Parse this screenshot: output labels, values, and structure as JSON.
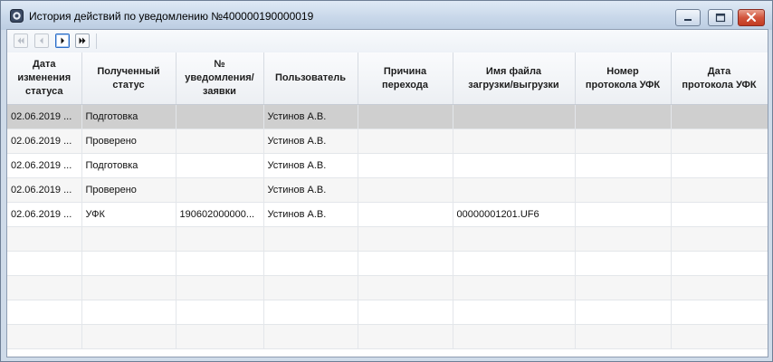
{
  "window": {
    "title": "История действий по уведомлению №400000190000019"
  },
  "toolbar": {
    "buttons": [
      {
        "name": "first-page",
        "icon": "double-left-icon",
        "enabled": false
      },
      {
        "name": "prev-page",
        "icon": "left-icon",
        "enabled": false
      },
      {
        "name": "next-page",
        "icon": "right-icon",
        "enabled": true
      },
      {
        "name": "last-page",
        "icon": "double-right-icon",
        "enabled": true
      }
    ]
  },
  "table": {
    "columns": [
      "Дата\nизменения\nстатуса",
      "Полученный\nстатус",
      "№\nуведомления/\nзаявки",
      "Пользователь",
      "Причина\nперехода",
      "Имя файла\nзагрузки/выгрузки",
      "Номер\nпротокола УФК",
      "Дата\nпротокола УФК"
    ],
    "rows": [
      [
        "02.06.2019 ...",
        "Подготовка",
        "",
        "Устинов А.В.",
        "",
        "",
        "",
        ""
      ],
      [
        "02.06.2019 ...",
        "Проверено",
        "",
        "Устинов А.В.",
        "",
        "",
        "",
        ""
      ],
      [
        "02.06.2019 ...",
        "Подготовка",
        "",
        "Устинов А.В.",
        "",
        "",
        "",
        ""
      ],
      [
        "02.06.2019 ...",
        "Проверено",
        "",
        "Устинов А.В.",
        "",
        "",
        "",
        ""
      ],
      [
        "02.06.2019 ...",
        "УФК",
        "190602000000...",
        "Устинов А.В.",
        "",
        "00000001201.UF6",
        "",
        ""
      ],
      [
        "",
        "",
        "",
        "",
        "",
        "",
        "",
        ""
      ],
      [
        "",
        "",
        "",
        "",
        "",
        "",
        "",
        ""
      ],
      [
        "",
        "",
        "",
        "",
        "",
        "",
        "",
        ""
      ],
      [
        "",
        "",
        "",
        "",
        "",
        "",
        "",
        ""
      ],
      [
        "",
        "",
        "",
        "",
        "",
        "",
        "",
        ""
      ]
    ],
    "selected_row": 0
  },
  "colors": {
    "selection": "#cfcfcf",
    "accent": "#2a6cc7"
  }
}
